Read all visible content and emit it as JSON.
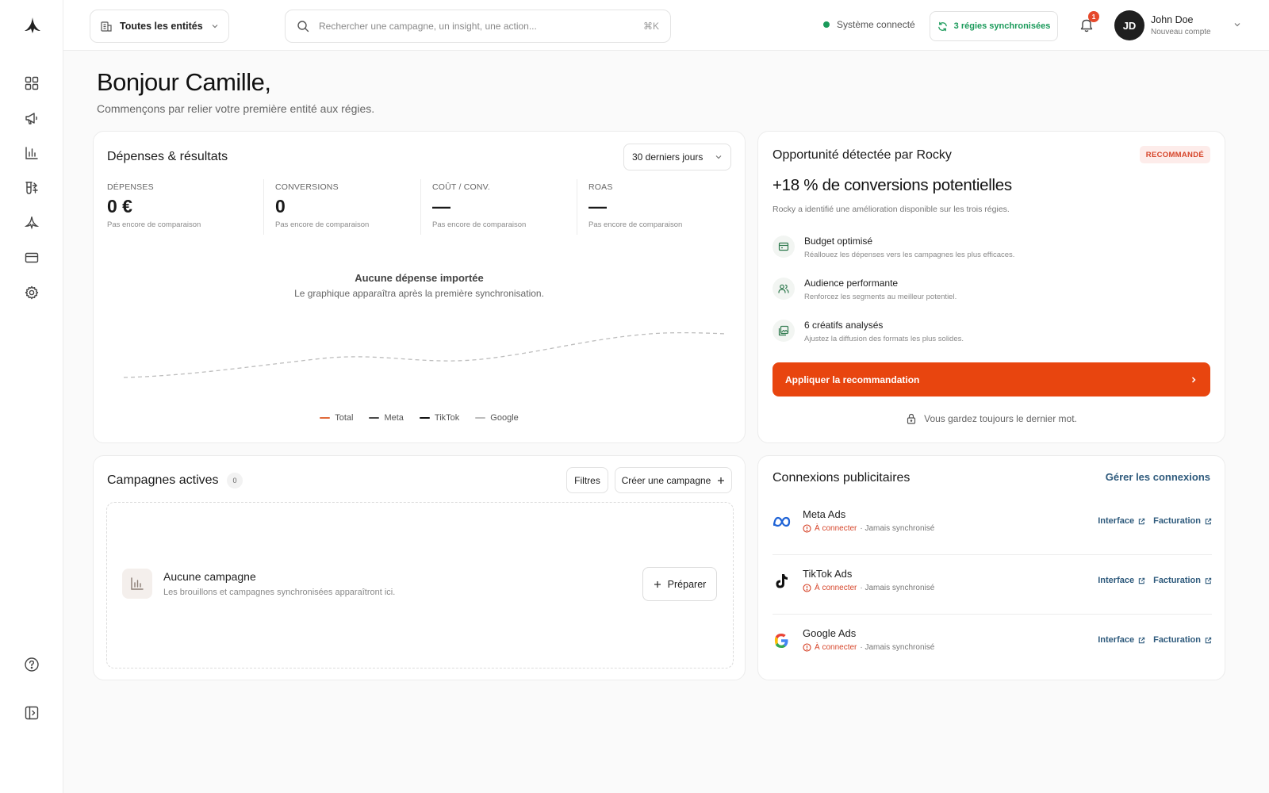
{
  "topbar": {
    "entity_label": "Toutes les entités",
    "search_placeholder": "Rechercher une campagne, un insight, une action...",
    "shortcut": "⌘K",
    "system_status": "Système connecté",
    "sync_label": "3 régies synchronisées",
    "notification_count": "1",
    "avatar_initials": "JD",
    "user_name": "John Doe",
    "user_subtitle": "Nouveau compte"
  },
  "sidebar": {
    "items": [
      {
        "icon": "dashboard-icon"
      },
      {
        "icon": "megaphone-icon"
      },
      {
        "icon": "bar-chart-icon"
      },
      {
        "icon": "flask-icon"
      },
      {
        "icon": "rocky-icon"
      },
      {
        "icon": "credit-card-icon"
      },
      {
        "icon": "gear-icon"
      }
    ],
    "bottom": [
      {
        "icon": "help-icon"
      },
      {
        "icon": "collapse-sidebar-icon"
      }
    ]
  },
  "header": {
    "greeting": "Bonjour Camille,",
    "subtitle": "Commençons par relier votre première entité aux régies."
  },
  "spend_card": {
    "title": "Dépenses & résultats",
    "period": "30 derniers jours",
    "kpis": [
      {
        "label": "DÉPENSES",
        "value": "0 €",
        "note": "Pas encore de comparaison"
      },
      {
        "label": "CONVERSIONS",
        "value": "0",
        "note": "Pas encore de comparaison"
      },
      {
        "label": "COÛT / CONV.",
        "value": "—",
        "note": "Pas encore de comparaison"
      },
      {
        "label": "ROAS",
        "value": "—",
        "note": "Pas encore de comparaison"
      }
    ],
    "empty_title": "Aucune dépense importée",
    "empty_subtitle": "Le graphique apparaîtra après la première synchronisation.",
    "legend": [
      {
        "label": "Total",
        "color": "#e06a3a"
      },
      {
        "label": "Meta",
        "color": "#4a4a4a"
      },
      {
        "label": "TikTok",
        "color": "#111111"
      },
      {
        "label": "Google",
        "color": "#bdbdbd"
      }
    ]
  },
  "opportunity": {
    "title": "Opportunité détectée par Rocky",
    "badge": "RECOMMANDÉ",
    "headline": "+18 % de conversions potentielles",
    "description": "Rocky a identifié une amélioration disponible sur les trois régies.",
    "items": [
      {
        "title": "Budget optimisé",
        "desc": "Réallouez les dépenses vers les campagnes les plus efficaces.",
        "icon": "wallet-icon"
      },
      {
        "title": "Audience performante",
        "desc": "Renforcez les segments au meilleur potentiel.",
        "icon": "users-icon"
      },
      {
        "title": "6 créatifs analysés",
        "desc": "Ajustez la diffusion des formats les plus solides.",
        "icon": "images-icon"
      }
    ],
    "apply_label": "Appliquer la recommandation",
    "footer": "Vous gardez toujours le dernier mot."
  },
  "campaigns": {
    "title": "Campagnes actives",
    "count": "0",
    "filters_label": "Filtres",
    "create_label": "Créer une campagne",
    "empty_title": "Aucune campagne",
    "empty_desc": "Les brouillons et campagnes synchronisées apparaîtront ici.",
    "prepare_label": "Préparer"
  },
  "connections": {
    "title": "Connexions publicitaires",
    "manage_label": "Gérer les connexions",
    "items": [
      {
        "name": "Meta Ads",
        "status": "À connecter",
        "sync": "· Jamais synchronisé",
        "interface_label": "Interface",
        "billing_label": "Facturation",
        "icon": "meta-logo-icon"
      },
      {
        "name": "TikTok Ads",
        "status": "À connecter",
        "sync": "· Jamais synchronisé",
        "interface_label": "Interface",
        "billing_label": "Facturation",
        "icon": "tiktok-logo-icon"
      },
      {
        "name": "Google Ads",
        "status": "À connecter",
        "sync": "· Jamais synchronisé",
        "interface_label": "Interface",
        "billing_label": "Facturation",
        "icon": "google-logo-icon"
      }
    ]
  },
  "colors": {
    "accent": "#e8450f",
    "success": "#1a9a5a",
    "link": "#2e5a7c",
    "warning": "#d6452a"
  }
}
